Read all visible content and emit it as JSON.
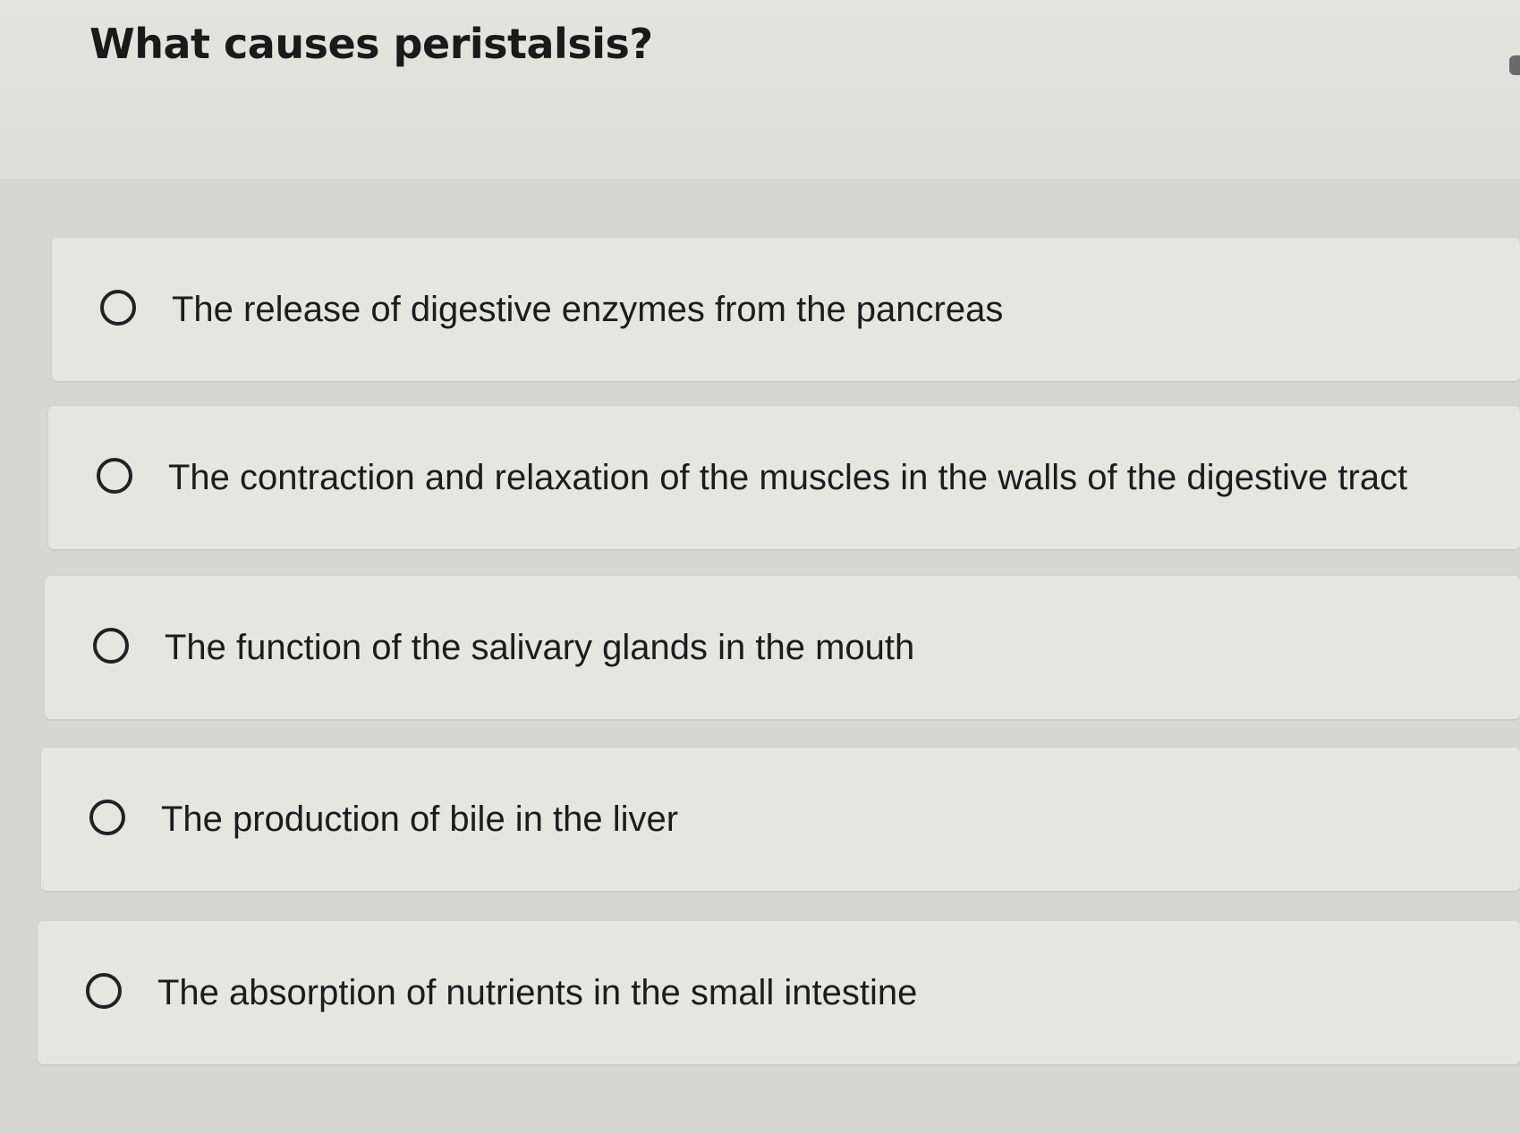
{
  "question": {
    "title": "What causes peristalsis?"
  },
  "options": [
    {
      "label": "The release of digestive enzymes from the pancreas",
      "selected": false
    },
    {
      "label": "The contraction and relaxation of the muscles in the walls of the digestive tract",
      "selected": false
    },
    {
      "label": "The function of the salivary glands in the mouth",
      "selected": false
    },
    {
      "label": "The production of bile in the liver",
      "selected": false
    },
    {
      "label": "The absorption of nutrients in the small intestine",
      "selected": false
    }
  ]
}
